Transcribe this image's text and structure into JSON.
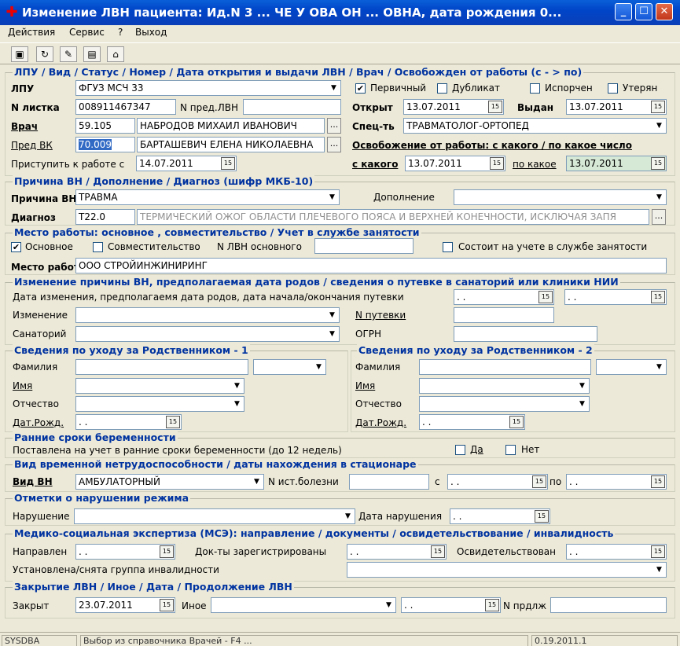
{
  "window": {
    "title": "Изменение ЛВН пациента: Ид.N 3 ... ЧЕ У ОВА ОН ... ОВНА, дата рождения 0...",
    "min_icon": "minimize-icon",
    "max_icon": "maximize-icon",
    "close_icon": "close-icon"
  },
  "menu": {
    "actions": "Действия",
    "service": "Сервис",
    "help": "?",
    "exit": "Выход"
  },
  "toolbar": [
    "save-icon",
    "refresh-icon",
    "doctor-icon",
    "book-icon",
    "home-icon"
  ],
  "g1": {
    "title": "ЛПУ / Вид / Статус / Номер / Дата открытия и выдачи ЛВН / Врач / Освобожден от работы (с - > по)",
    "lpu_label": "ЛПУ",
    "lpu": "ФГУЗ МСЧ 33",
    "primary": "Первичный",
    "duplicate": "Дубликат",
    "spoiled": "Испорчен",
    "lost": "Утерян",
    "nlist_label": "N листка",
    "nlist": "008911467347",
    "nprev_label": "N пред.ЛВН",
    "opened_label": "Открыт",
    "opened": "13.07.2011",
    "issued_label": "Выдан",
    "issued": "13.07.2011",
    "doctor_label": "Врач",
    "doctor_code": "59.105",
    "doctor_name": "НАБРОДОВ МИХАИЛ ИВАНОВИЧ",
    "spec_label": "Спец-ть",
    "spec": "ТРАВМАТОЛОГ-ОРТОПЕД",
    "vk_label": "Пред ВК",
    "vk_code": "70.009",
    "vk_name": "БАРТАШЕВИЧ ЕЛЕНА НИКОЛАЕВНА",
    "release_title": "Освобожение от работы: с какого / по какое число",
    "return_label": "Приступить к работе с",
    "return": "14.07.2011",
    "from_label": "с какого",
    "from": "13.07.2011",
    "to_label": "по какое",
    "to": "13.07.2011"
  },
  "g2": {
    "title": "Причина ВН / Дополнение / Диагноз (шифр МКБ-10)",
    "reason_label": "Причина ВН",
    "reason": "ТРАВМА",
    "addition_label": "Дополнение",
    "diag_label": "Диагноз",
    "diag_code": "T22.0",
    "diag_text": "ТЕРМИЧЕСКИЙ ОЖОГ ОБЛАСТИ ПЛЕЧЕВОГО ПОЯСА И ВЕРХНЕЙ КОНЕЧНОСТИ, ИСКЛЮЧАЯ ЗАПЯ"
  },
  "g3": {
    "title": "Место работы: основное , совместительство / Учет в службе занятости",
    "main": "Основное",
    "partial": "Совместительство",
    "nmain": "N ЛВН основного",
    "employment": "Состоит на учете в службе занятости",
    "work_label": "Место работ",
    "work": "ООО СТРОЙИНЖИНИРИНГ"
  },
  "g4": {
    "title": "Изменение причины ВН, предполагаемая дата родов / сведения о путевке в санаторий или клиники НИИ",
    "dates_label": "Дата изменения, предполагаемя дата родов, дата начала/окончания путевки",
    "date1": " .  .",
    "date2": " .  .",
    "change_label": "Изменение",
    "voucher_label": "N путевки",
    "sanat_label": "Санаторий",
    "ogrn_label": "ОГРН"
  },
  "g5": {
    "title": "Сведения по уходу за Родственником - 1",
    "surname": "Фамилия",
    "name": "Имя",
    "patronymic": "Отчество",
    "dob": "Дат.Рожд.",
    "dob_val": " .  ."
  },
  "g6": {
    "title": "Сведения по уходу за Родственником - 2",
    "surname": "Фамилия",
    "name": "Имя",
    "patronymic": "Отчество",
    "dob": "Дат.Рожд.",
    "dob_val": " .  ."
  },
  "g7": {
    "title": "Ранние сроки беременности",
    "question": "Поставлена на учет в ранние сроки беременности (до 12 недель)",
    "yes": "Да",
    "no": "Нет"
  },
  "g8": {
    "title": "Вид временной нетрудоспособности / даты нахождения в стационаре",
    "kind_label": "Вид ВН",
    "kind": "АМБУЛАТОРНЫЙ",
    "hist_label": "N ист.болезни",
    "from_label": "с",
    "from": " .  .",
    "to_label": "по",
    "to": " .  ."
  },
  "g9": {
    "title": "Отметки о нарушении режима",
    "violation_label": "Нарушение",
    "date_label": "Дата нарушения",
    "date": " .  ."
  },
  "g10": {
    "title": "Медико-социальная экспертиза (МСЭ): направление / документы / освидетельствование / инвалидность",
    "sent_label": "Направлен",
    "sent": " .  .",
    "docs_label": "Док-ты зарегистрированы",
    "docs": " .  .",
    "exam_label": "Освидетельствован",
    "exam": " .  .",
    "group_label": "Установлена/снята группа инвалидности"
  },
  "g11": {
    "title": "Закрытие ЛВН / Иное / Дата / Продолжение ЛВН",
    "closed_label": "Закрыт",
    "closed": "23.07.2011",
    "other_label": "Иное",
    "other_date": " .  .",
    "cont_label": "N прдлж"
  },
  "status": {
    "user": "SYSDBA",
    "hint": "Выбор из справочника Врачей - F4 ...",
    "version": "0.19.2011.1"
  }
}
